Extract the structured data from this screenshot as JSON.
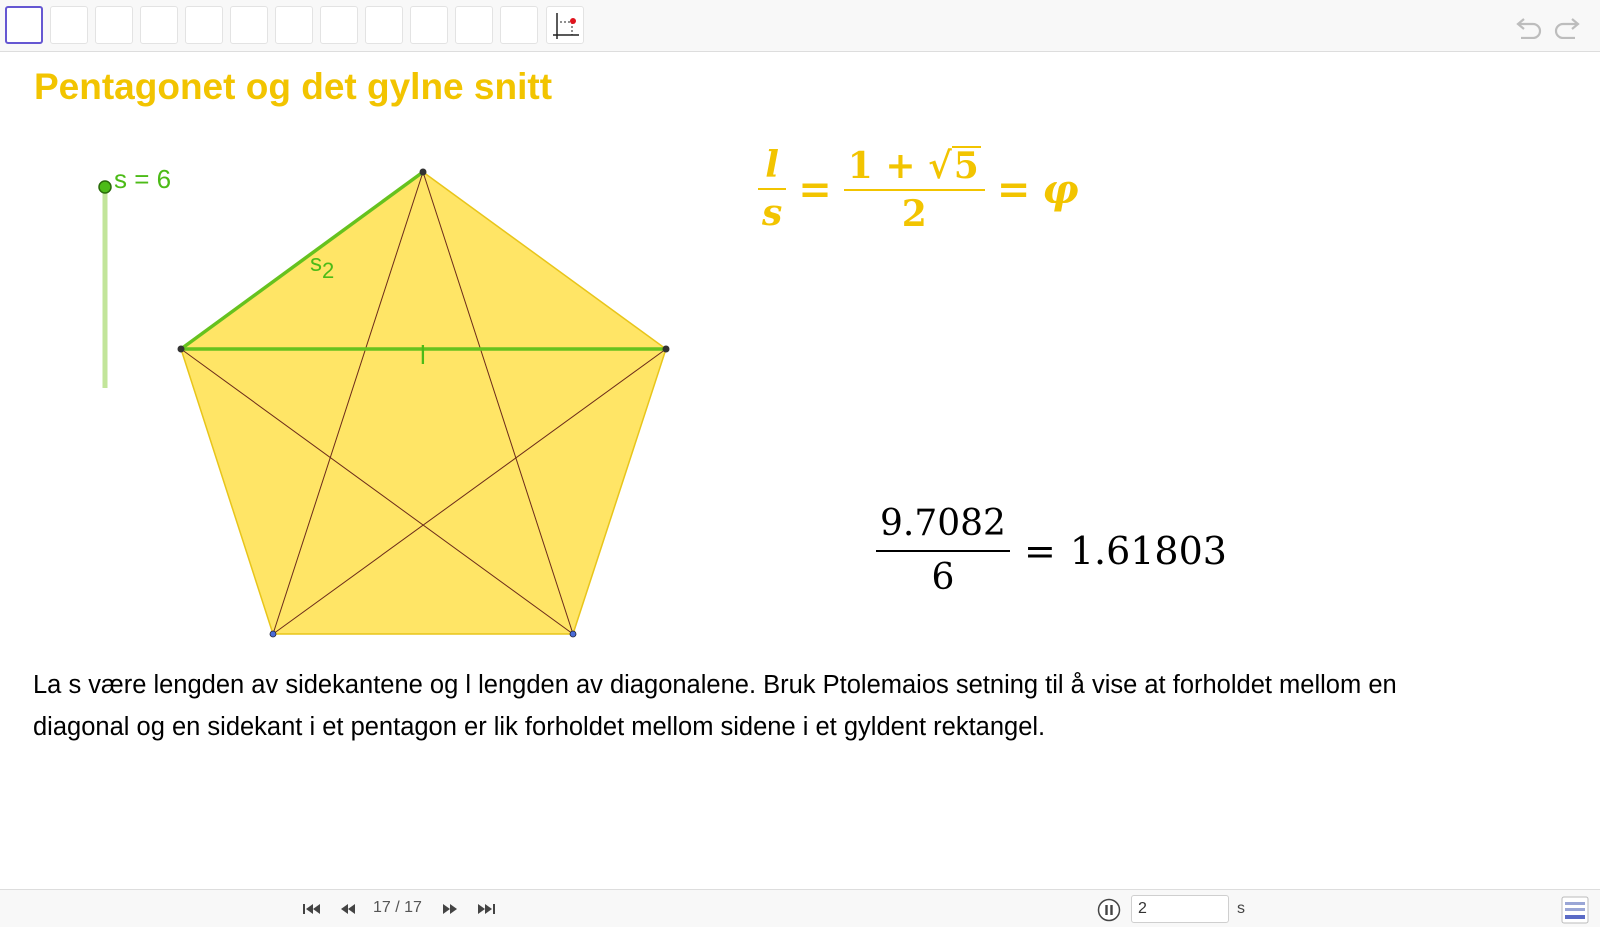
{
  "toolbar": {
    "tool_count": 12
  },
  "canvas": {
    "title": "Pentagonet og det gylne snitt",
    "slider_label": "s = 6",
    "segment_label_name": "s",
    "segment_label_index": "2",
    "diagonal_label": "l",
    "formula": {
      "lhs_num": "l",
      "lhs_den": "s",
      "eq1": "=",
      "mid_num_prefix": "1 + ",
      "mid_num_radicand": "5",
      "mid_den": "2",
      "eq2": "=",
      "rhs": "φ"
    },
    "ratio": {
      "numerator": "9.7082",
      "denominator": "6",
      "equals": "=",
      "result": "1.61803"
    },
    "description": "La s være lengden av sidekantene og l lengden av diagonalene. Bruk Ptolemaios setning til å vise at forholdet mellom en diagonal og en sidekant i et pentagon er lik forholdet mellom sidene i et gyldent rektangel."
  },
  "bottombar": {
    "page_indicator": "17 / 17",
    "speed_value": "2",
    "speed_unit": "s"
  },
  "colors": {
    "accent_yellow": "#f2c400",
    "pentagon_fill": "#ffe566",
    "green": "#4cbb17",
    "selected_tool": "#6557d2"
  }
}
